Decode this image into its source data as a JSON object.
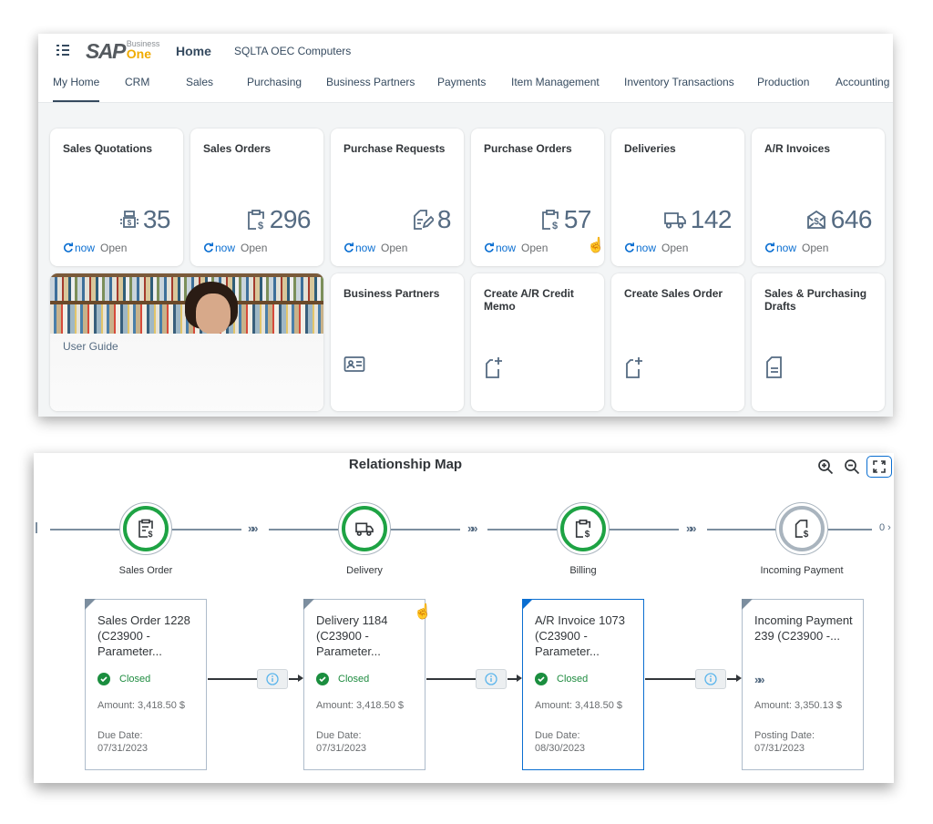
{
  "shell": {
    "menu_icon": "hamburger-menu-icon",
    "logo_main": "SAP",
    "logo_business": "Business",
    "logo_one": "One",
    "title": "Home",
    "company": "SQLTA OEC Computers"
  },
  "tabs": [
    {
      "label": "My Home",
      "active": true
    },
    {
      "label": "CRM"
    },
    {
      "label": "Sales"
    },
    {
      "label": "Purchasing"
    },
    {
      "label": "Business Partners"
    },
    {
      "label": "Payments"
    },
    {
      "label": "Item Management"
    },
    {
      "label": "Inventory Transactions"
    },
    {
      "label": "Production"
    },
    {
      "label": "Accounting"
    }
  ],
  "kpi_tiles": [
    {
      "title": "Sales Quotations",
      "icon": "sales-quotation-icon",
      "value": "35",
      "refresh": "now",
      "status": "Open"
    },
    {
      "title": "Sales Orders",
      "icon": "sales-order-icon",
      "value": "296",
      "refresh": "now",
      "status": "Open"
    },
    {
      "title": "Purchase Requests",
      "icon": "purchase-request-icon",
      "value": "8",
      "refresh": "now",
      "status": "Open"
    },
    {
      "title": "Purchase Orders",
      "icon": "purchase-order-icon",
      "value": "57",
      "refresh": "now",
      "status": "Open"
    },
    {
      "title": "Deliveries",
      "icon": "truck-icon",
      "value": "142",
      "refresh": "now",
      "status": "Open"
    },
    {
      "title": "A/R Invoices",
      "icon": "invoice-icon",
      "value": "646",
      "refresh": "now",
      "status": "Open"
    }
  ],
  "action_tiles": [
    {
      "title": "User Guide",
      "icon": "user-guide-image"
    },
    {
      "title": "Business Partners",
      "icon": "business-card-icon"
    },
    {
      "title": "Create A/R Credit Memo",
      "icon": "create-document-icon"
    },
    {
      "title": "Create Sales Order",
      "icon": "create-document-icon"
    },
    {
      "title": "Sales & Purchasing Drafts",
      "icon": "document-text-icon"
    }
  ],
  "relationship_map": {
    "title": "Relationship Map",
    "tools": [
      "zoom-in-icon",
      "zoom-out-icon",
      "fit-to-screen-icon"
    ],
    "chevrons": "»»",
    "end_count": "0",
    "lanes": [
      {
        "label": "Sales Order",
        "icon": "sales-order-icon",
        "state": "completed"
      },
      {
        "label": "Delivery",
        "icon": "truck-icon",
        "state": "completed"
      },
      {
        "label": "Billing",
        "icon": "invoice-clipboard-icon",
        "state": "completed"
      },
      {
        "label": "Incoming Payment",
        "icon": "payment-document-icon",
        "state": "pending"
      }
    ],
    "documents": [
      {
        "title": "Sales Order 1228 (C23900 - Parameter...",
        "status": "Closed",
        "amount": "Amount: 3,418.50 $",
        "date_label": "Due Date:",
        "date": "07/31/2023",
        "selected": false
      },
      {
        "title": "Delivery 1184 (C23900 - Parameter...",
        "status": "Closed",
        "amount": "Amount: 3,418.50 $",
        "date_label": "Due Date:",
        "date": "07/31/2023",
        "selected": false
      },
      {
        "title": "A/R Invoice 1073 (C23900 - Parameter...",
        "status": "Closed",
        "amount": "Amount: 3,418.50 $",
        "date_label": "Due Date:",
        "date": "08/30/2023",
        "selected": true
      },
      {
        "title": "Incoming Payment 239 (C23900 -...",
        "status": "»»",
        "amount": "Amount: 3,350.13 $",
        "date_label": "Posting Date:",
        "date": "07/31/2023",
        "selected": false
      }
    ]
  },
  "colors": {
    "accent": "#0a6ed1",
    "success": "#1ea344",
    "shell_text": "#354a5f",
    "kpi_value": "#556b82",
    "logo_yellow": "#f0ab00"
  }
}
